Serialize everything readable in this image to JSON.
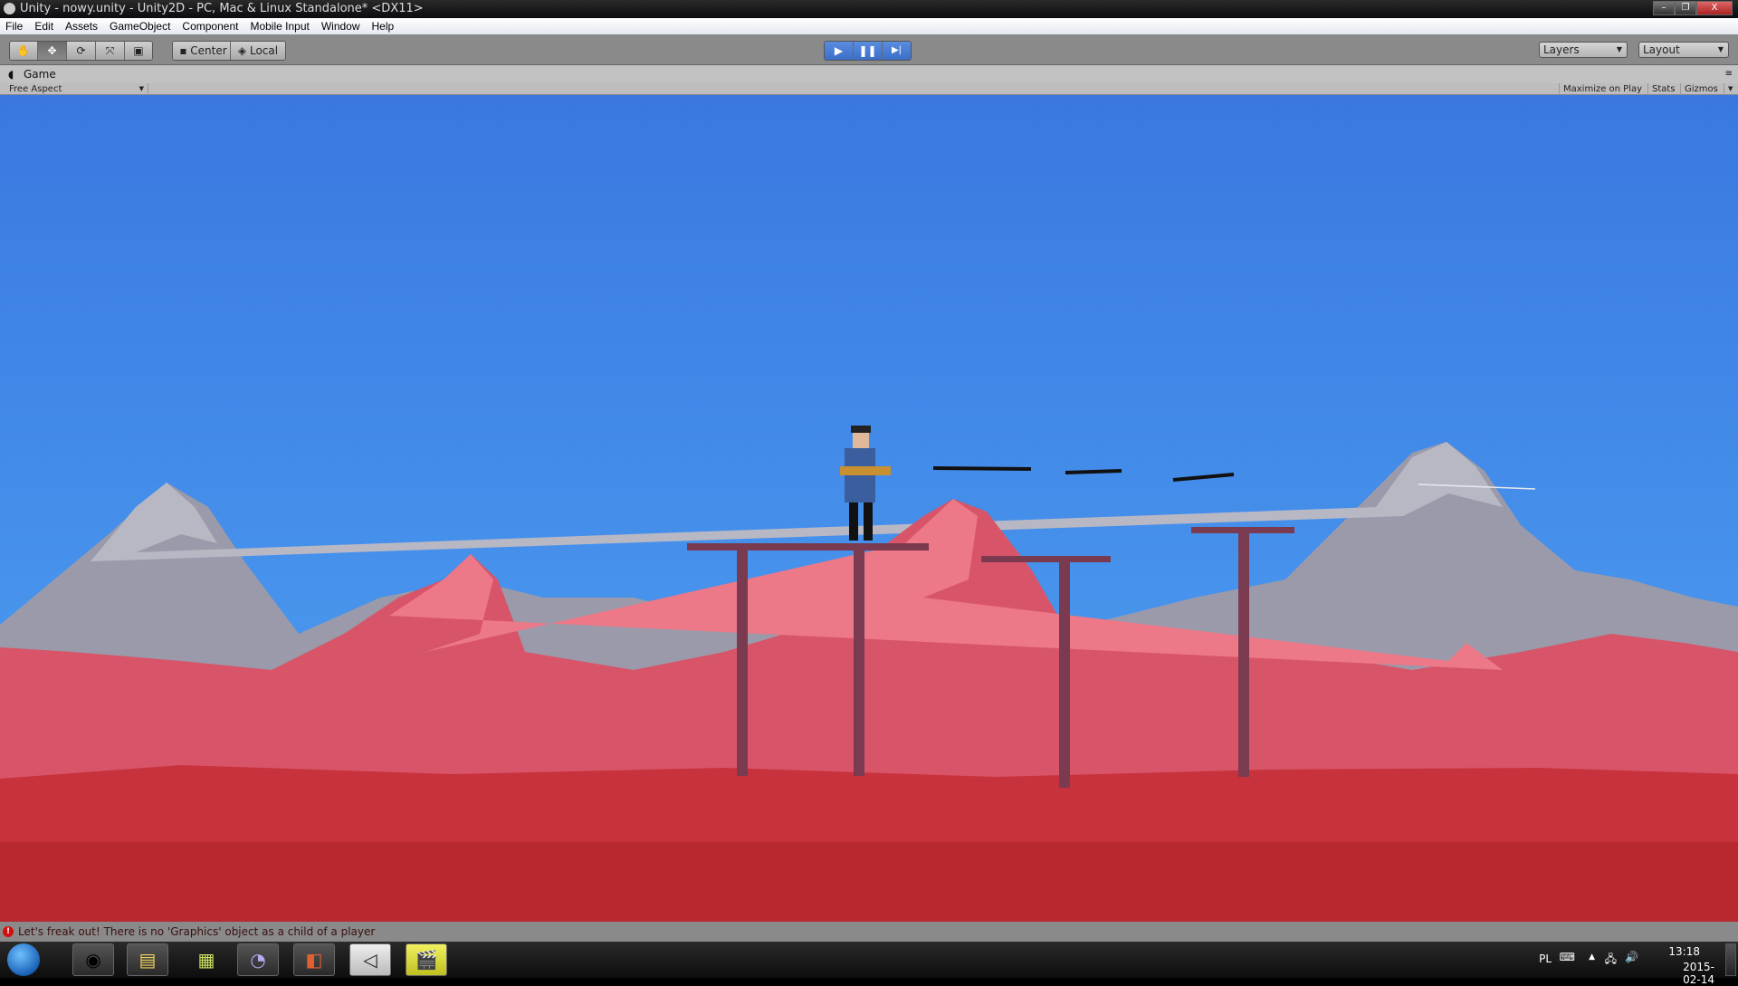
{
  "window": {
    "title": "Unity - nowy.unity - Unity2D - PC, Mac & Linux Standalone* <DX11>",
    "minimize": "–",
    "restore": "❐",
    "close": "X"
  },
  "menu": [
    "File",
    "Edit",
    "Assets",
    "GameObject",
    "Component",
    "Mobile Input",
    "Window",
    "Help"
  ],
  "toolbar": {
    "tools": [
      "hand-tool",
      "move-tool",
      "rotate-tool",
      "scale-tool",
      "rect-tool"
    ],
    "pivot": "Center",
    "space": "Local",
    "play": "▶",
    "pause": "❚❚",
    "step": "▶|",
    "layers": "Layers",
    "layout": "Layout"
  },
  "game": {
    "tab": "Game",
    "aspect": "Free Aspect",
    "maximize": "Maximize on Play",
    "stats": "Stats",
    "gizmos": "Gizmos"
  },
  "colors": {
    "sky_top": "#3a78e0",
    "sky_bottom": "#4a9cf0",
    "mountain": "#9a9aa8",
    "rock": "#e06070",
    "ground": "#c0303a",
    "pillar": "#7a3a50"
  },
  "status": {
    "message": "Let's freak out! There is no 'Graphics' object as a child of a player"
  },
  "taskbar": {
    "apps": [
      "chrome",
      "explorer",
      "video",
      "bittorrent",
      "avg",
      "unity",
      "media-player-classic"
    ],
    "lang": "PL",
    "time": "13:18",
    "date": "2015-02-14"
  }
}
